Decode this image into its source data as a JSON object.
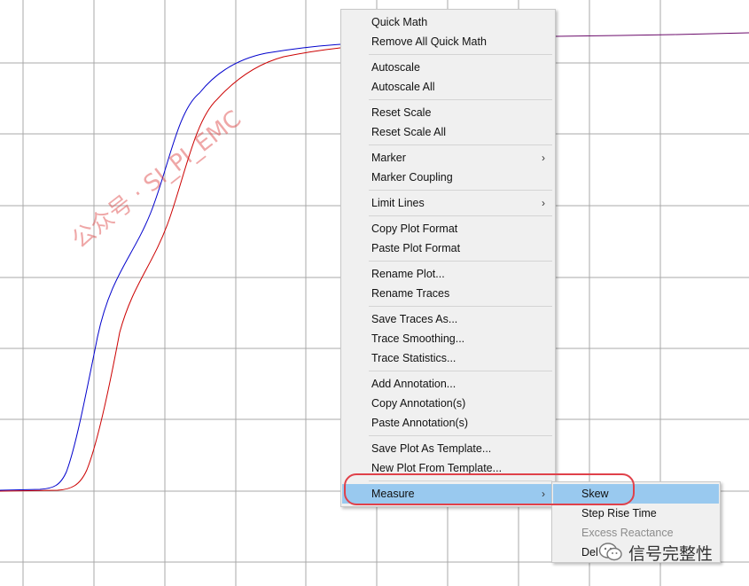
{
  "menu": {
    "groups": [
      [
        "Quick Math",
        "Remove All Quick Math"
      ],
      [
        "Autoscale",
        "Autoscale All"
      ],
      [
        "Reset Scale",
        "Reset Scale All"
      ],
      [
        "Marker",
        "Marker Coupling"
      ],
      [
        "Limit Lines"
      ],
      [
        "Copy Plot Format",
        "Paste Plot Format"
      ],
      [
        "Rename Plot...",
        "Rename Traces"
      ],
      [
        "Save Traces As...",
        "Trace Smoothing...",
        "Trace Statistics..."
      ],
      [
        "Add Annotation...",
        "Copy Annotation(s)",
        "Paste Annotation(s)"
      ],
      [
        "Save Plot As Template...",
        "New Plot From Template..."
      ],
      [
        "Measure"
      ]
    ],
    "submenu_items": [
      "Marker",
      "Limit Lines",
      "Measure"
    ],
    "highlighted": "Measure"
  },
  "submenu": {
    "items": [
      {
        "label": "Skew",
        "state": "highlighted"
      },
      {
        "label": "Step Rise Time",
        "state": "enabled"
      },
      {
        "label": "Excess Reactance",
        "state": "disabled"
      },
      {
        "label": "Del",
        "state": "enabled"
      }
    ]
  },
  "watermark": "公众号 · SI_PI_EMC",
  "badge": {
    "text": "信号完整性",
    "icon": "wechat-icon"
  },
  "colors": {
    "trace1": "#0000cc",
    "trace2": "#cc0000",
    "highlight": "#99c9ef",
    "callout": "#e0414a"
  }
}
